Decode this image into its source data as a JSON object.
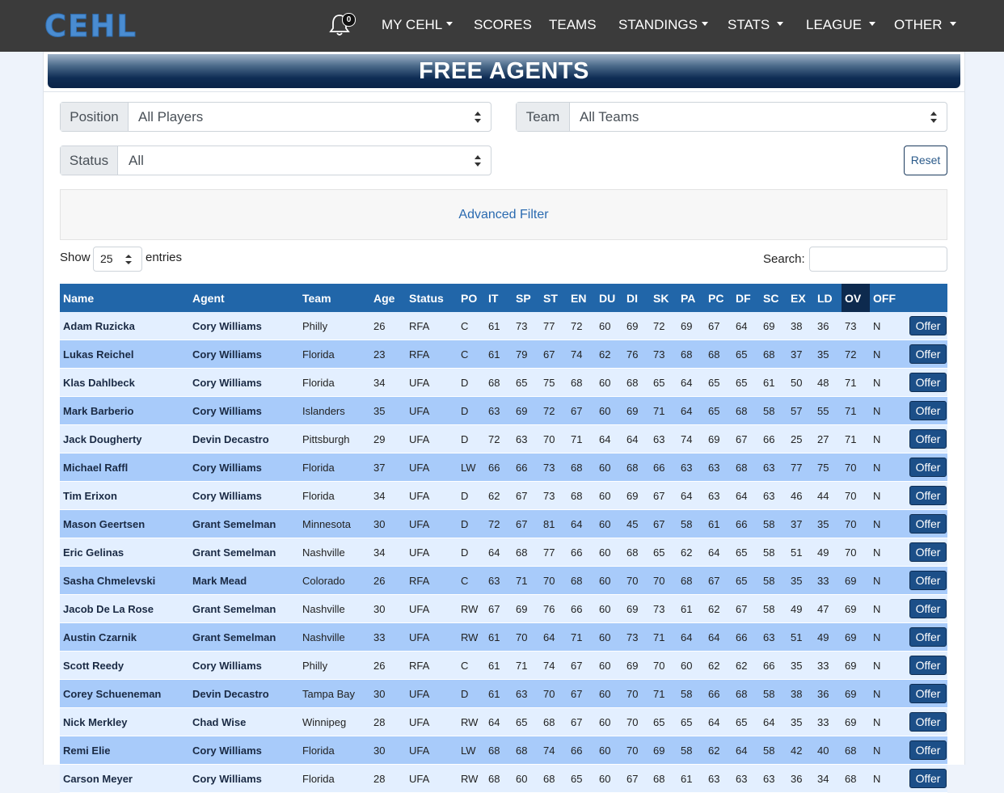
{
  "nav": {
    "logo": "CEHL",
    "notifications_count": "0",
    "items": [
      "MY CEHL",
      "SCORES",
      "TEAMS",
      "STANDINGS",
      "STATS",
      "LEAGUE",
      "OTHER"
    ]
  },
  "page": {
    "title": "FREE AGENTS"
  },
  "filters": {
    "position_label": "Position",
    "position_value": "All Players",
    "team_label": "Team",
    "team_value": "All Teams",
    "status_label": "Status",
    "status_value": "All",
    "reset_label": "Reset",
    "advanced_label": "Advanced Filter"
  },
  "table_controls": {
    "show_label": "Show",
    "page_length": "25",
    "entries_label": "entries",
    "search_label": "Search:",
    "search_value": ""
  },
  "table": {
    "headers": [
      "Name",
      "Agent",
      "Team",
      "Age",
      "Status",
      "PO",
      "IT",
      "SP",
      "ST",
      "EN",
      "DU",
      "DI",
      "SK",
      "PA",
      "PC",
      "DF",
      "SC",
      "EX",
      "LD",
      "OV",
      "OFF"
    ],
    "offer_label": "Offer",
    "rows": [
      [
        "Adam Ruzicka",
        "Cory Williams",
        "Philly",
        "26",
        "RFA",
        "C",
        "61",
        "73",
        "77",
        "72",
        "60",
        "69",
        "72",
        "69",
        "67",
        "64",
        "69",
        "38",
        "36",
        "73",
        "N"
      ],
      [
        "Lukas Reichel",
        "Cory Williams",
        "Florida",
        "23",
        "RFA",
        "C",
        "61",
        "79",
        "67",
        "74",
        "62",
        "76",
        "73",
        "68",
        "68",
        "65",
        "68",
        "37",
        "35",
        "72",
        "N"
      ],
      [
        "Klas Dahlbeck",
        "Cory Williams",
        "Florida",
        "34",
        "UFA",
        "D",
        "68",
        "65",
        "75",
        "68",
        "60",
        "68",
        "65",
        "64",
        "65",
        "65",
        "61",
        "50",
        "48",
        "71",
        "N"
      ],
      [
        "Mark Barberio",
        "Cory Williams",
        "Islanders",
        "35",
        "UFA",
        "D",
        "63",
        "69",
        "72",
        "67",
        "60",
        "69",
        "71",
        "64",
        "65",
        "68",
        "58",
        "57",
        "55",
        "71",
        "N"
      ],
      [
        "Jack Dougherty",
        "Devin Decastro",
        "Pittsburgh",
        "29",
        "UFA",
        "D",
        "72",
        "63",
        "70",
        "71",
        "64",
        "64",
        "63",
        "74",
        "69",
        "67",
        "66",
        "25",
        "27",
        "71",
        "N"
      ],
      [
        "Michael Raffl",
        "Cory Williams",
        "Florida",
        "37",
        "UFA",
        "LW",
        "66",
        "66",
        "73",
        "68",
        "60",
        "68",
        "66",
        "63",
        "63",
        "68",
        "63",
        "77",
        "75",
        "70",
        "N"
      ],
      [
        "Tim Erixon",
        "Cory Williams",
        "Florida",
        "34",
        "UFA",
        "D",
        "62",
        "67",
        "73",
        "68",
        "60",
        "69",
        "67",
        "64",
        "63",
        "64",
        "63",
        "46",
        "44",
        "70",
        "N"
      ],
      [
        "Mason Geertsen",
        "Grant Semelman",
        "Minnesota",
        "30",
        "UFA",
        "D",
        "72",
        "67",
        "81",
        "64",
        "60",
        "45",
        "67",
        "58",
        "61",
        "66",
        "58",
        "37",
        "35",
        "70",
        "N"
      ],
      [
        "Eric Gelinas",
        "Grant Semelman",
        "Nashville",
        "34",
        "UFA",
        "D",
        "64",
        "68",
        "77",
        "66",
        "60",
        "68",
        "65",
        "62",
        "64",
        "65",
        "58",
        "51",
        "49",
        "70",
        "N"
      ],
      [
        "Sasha Chmelevski",
        "Mark Mead",
        "Colorado",
        "26",
        "RFA",
        "C",
        "63",
        "71",
        "70",
        "68",
        "60",
        "70",
        "70",
        "68",
        "67",
        "65",
        "58",
        "35",
        "33",
        "69",
        "N"
      ],
      [
        "Jacob De La Rose",
        "Grant Semelman",
        "Nashville",
        "30",
        "UFA",
        "RW",
        "67",
        "69",
        "76",
        "66",
        "60",
        "69",
        "73",
        "61",
        "62",
        "67",
        "58",
        "49",
        "47",
        "69",
        "N"
      ],
      [
        "Austin Czarnik",
        "Grant Semelman",
        "Nashville",
        "33",
        "UFA",
        "RW",
        "61",
        "70",
        "64",
        "71",
        "60",
        "73",
        "71",
        "64",
        "64",
        "66",
        "63",
        "51",
        "49",
        "69",
        "N"
      ],
      [
        "Scott Reedy",
        "Cory Williams",
        "Philly",
        "26",
        "RFA",
        "C",
        "61",
        "71",
        "74",
        "67",
        "60",
        "69",
        "70",
        "60",
        "62",
        "62",
        "66",
        "35",
        "33",
        "69",
        "N"
      ],
      [
        "Corey Schueneman",
        "Devin Decastro",
        "Tampa Bay",
        "30",
        "UFA",
        "D",
        "61",
        "63",
        "70",
        "67",
        "60",
        "70",
        "71",
        "58",
        "66",
        "68",
        "58",
        "38",
        "36",
        "69",
        "N"
      ],
      [
        "Nick Merkley",
        "Chad Wise",
        "Winnipeg",
        "28",
        "UFA",
        "RW",
        "64",
        "65",
        "68",
        "67",
        "60",
        "70",
        "65",
        "65",
        "64",
        "65",
        "64",
        "35",
        "33",
        "69",
        "N"
      ],
      [
        "Remi Elie",
        "Cory Williams",
        "Florida",
        "30",
        "UFA",
        "LW",
        "68",
        "68",
        "74",
        "66",
        "60",
        "70",
        "69",
        "58",
        "62",
        "64",
        "58",
        "42",
        "40",
        "68",
        "N"
      ],
      [
        "Carson Meyer",
        "Cory Williams",
        "Florida",
        "28",
        "UFA",
        "RW",
        "68",
        "60",
        "68",
        "65",
        "60",
        "67",
        "68",
        "61",
        "63",
        "63",
        "63",
        "36",
        "34",
        "68",
        "N"
      ]
    ]
  }
}
